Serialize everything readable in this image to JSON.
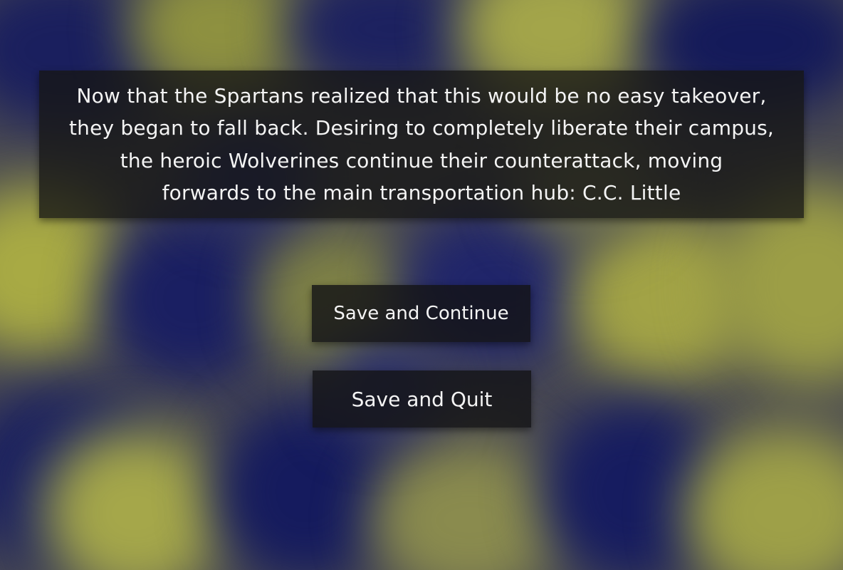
{
  "story": {
    "lines": [
      "Now that the Spartans realized that this would be no easy takeover,",
      "they began to fall back. Desiring to completely liberate their campus,",
      "the heroic Wolverines continue their counterattack, moving",
      "forwards to the main transportation hub: C.C. Little"
    ]
  },
  "menu": {
    "save_continue_label": "Save and Continue",
    "save_quit_label": "Save and Quit"
  },
  "colors": {
    "maize": "#a9ab42",
    "blue": "#131a5c",
    "panel": "#161614",
    "text": "#f4f4f4"
  }
}
